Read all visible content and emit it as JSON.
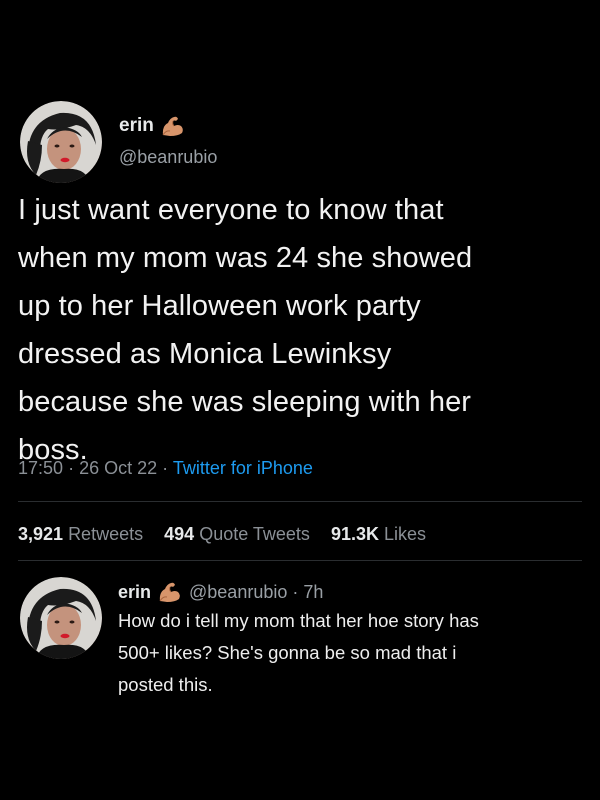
{
  "tweet": {
    "author": {
      "display_name": "erin",
      "handle": "@beanrubio",
      "emoji": "flexed-arm-emoji"
    },
    "text_lines": [
      "I just want everyone to know that",
      "when my mom was 24 she showed",
      "up to her Halloween work party",
      "dressed as Monica Lewinksy",
      "because she was sleeping with her",
      "boss."
    ],
    "time": "17:50",
    "separator": "·",
    "date": "26 Oct 22",
    "source": "Twitter for iPhone",
    "stats": {
      "retweets_count": "3,921",
      "retweets_label": "Retweets",
      "quotes_count": "494",
      "quotes_label": "Quote Tweets",
      "likes_count": "91.3K",
      "likes_label": "Likes"
    }
  },
  "reply": {
    "display_name": "erin",
    "handle_time": "@beanrubio · 7h",
    "text_lines": [
      "How do i tell my mom that her hoe story has",
      "500+ likes? She's gonna be so mad that i",
      "posted this."
    ]
  },
  "colors": {
    "background": "#000000",
    "primary_text": "#e7e9ea",
    "secondary_text": "#8b9096",
    "link": "#1d9bf0"
  }
}
